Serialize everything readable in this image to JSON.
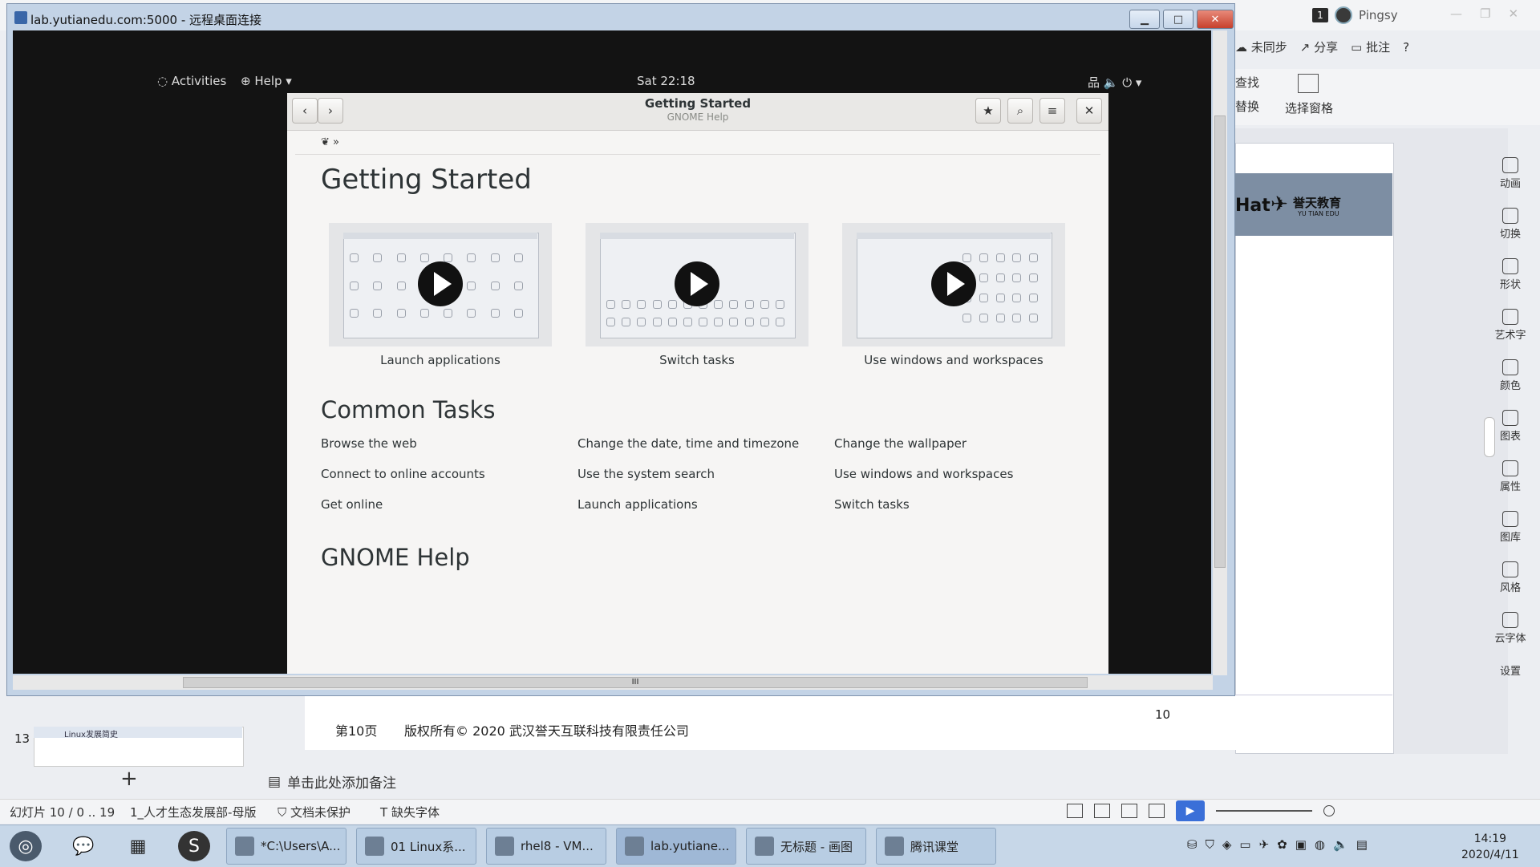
{
  "wps": {
    "user_badge": "1",
    "user_name": "Pingsy",
    "toolbar": {
      "sync": "未同步",
      "share": "分享",
      "comment": "批注",
      "help": "?"
    },
    "ribbon": {
      "find": "查找",
      "replace": "替换",
      "select_pane": "选择窗格"
    },
    "slide_banner": {
      "logo": "Hat",
      "brand": "誉天教育",
      "brand_sub": "YU TIAN EDU"
    },
    "right_tools": [
      "动画",
      "切换",
      "形状",
      "艺术字",
      "颜色",
      "图表",
      "属性",
      "图库",
      "风格",
      "云字体",
      "设置"
    ],
    "footer": {
      "page": "第10页",
      "copyright": "版权所有© 2020 武汉誉天互联科技有限责任公司",
      "number": "10"
    },
    "thumb": {
      "num": "13",
      "title": "Linux发展简史"
    },
    "notes_placeholder": "单击此处添加备注",
    "status": {
      "slide_info": "幻灯片 10 / 0 .. 19",
      "template": "1_人才生态发展部-母版",
      "protect": "文档未保护",
      "missing_font": "缺失字体"
    }
  },
  "rdp": {
    "title": "lab.yutianedu.com:5000 - 远程桌面连接",
    "btn_min": "▁",
    "btn_max": "□",
    "btn_close": "✕",
    "hscroll_label": "III"
  },
  "gnome": {
    "activities": "Activities",
    "help_menu": "Help ▾",
    "clock": "Sat 22:18",
    "tray": "品  🔈  ⏻ ▾"
  },
  "help": {
    "title": "Getting Started",
    "subtitle": "GNOME Help",
    "breadcrumb": "❦ »",
    "heading": "Getting Started",
    "videos": [
      {
        "caption": "Launch applications"
      },
      {
        "caption": "Switch tasks"
      },
      {
        "caption": "Use windows and workspaces"
      }
    ],
    "common_heading": "Common Tasks",
    "tasks": [
      [
        "Browse the web",
        "Change the date, time and timezone",
        "Change the wallpaper"
      ],
      [
        "Connect to online accounts",
        "Use the system search",
        "Use windows and workspaces"
      ],
      [
        "Get online",
        "Launch applications",
        "Switch tasks"
      ]
    ],
    "footer_heading": "GNOME Help"
  },
  "taskbar": {
    "tasks": [
      "*C:\\Users\\A...",
      "01 Linux系...",
      "rhel8 - VM...",
      "lab.yutiane...",
      "无标题 - 画图",
      "腾讯课堂"
    ],
    "clock_time": "14:19",
    "clock_date": "2020/4/11"
  }
}
